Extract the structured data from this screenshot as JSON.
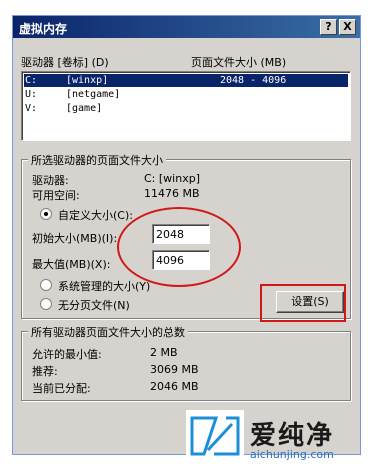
{
  "window": {
    "title": "虚拟内存",
    "help_button": "?",
    "close_button": "X"
  },
  "drives_list": {
    "header_drive": "驱动器 [卷标] (D)",
    "header_size": "页面文件大小 (MB)",
    "rows": [
      {
        "drive": "C:",
        "label": "[winxp]",
        "size": "2048 - 4096",
        "selected": true
      },
      {
        "drive": "U:",
        "label": "[netgame]",
        "size": "",
        "selected": false
      },
      {
        "drive": "V:",
        "label": "[game]",
        "size": "",
        "selected": false
      }
    ]
  },
  "selected_drive": {
    "group_title": "所选驱动器的页面文件大小",
    "drive_label": "驱动器:",
    "drive_value": "C:  [winxp]",
    "free_label": "可用空间:",
    "free_value": "11476 MB",
    "custom_size_label": "自定义大小(C):",
    "initial_label": "初始大小(MB)(I):",
    "initial_value": "2048",
    "max_label": "最大值(MB)(X):",
    "max_value": "4096",
    "system_managed_label": "系统管理的大小(Y)",
    "no_paging_label": "无分页文件(N)",
    "set_button": "设置(S)",
    "selected_option": "custom"
  },
  "totals": {
    "group_title": "所有驱动器页面文件大小的总数",
    "min_label": "允许的最小值:",
    "min_value": "2 MB",
    "recommended_label": "推荐:",
    "recommended_value": "3069 MB",
    "allocated_label": "当前已分配:",
    "allocated_value": "2046 MB"
  },
  "watermark": {
    "brand": "爱纯净",
    "url": "aichunjing.com"
  },
  "colors": {
    "titlebar": "#0a246a",
    "selection": "#0a246a",
    "annotation_red": "#d01818",
    "dialog_face": "#d6d3ce"
  }
}
